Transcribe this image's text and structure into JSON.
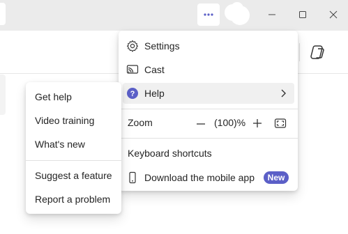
{
  "menu": {
    "settings_label": "Settings",
    "cast_label": "Cast",
    "help_label": "Help",
    "zoom_label": "Zoom",
    "zoom_value": "(100)%",
    "shortcuts_label": "Keyboard shortcuts",
    "mobile_label": "Download the mobile app",
    "new_badge": "New"
  },
  "help_submenu": {
    "items": [
      "Get help",
      "Video training",
      "What's new",
      "Suggest a feature",
      "Report a problem"
    ]
  },
  "colors": {
    "accent": "#5b5fc7",
    "titlebar": "#ebebeb"
  },
  "icons": {
    "more": "more-horizontal-icon",
    "settings": "gear-icon",
    "cast": "cast-icon",
    "help": "help-circle-icon",
    "zoom_out": "minus-icon",
    "zoom_in": "plus-icon",
    "fullscreen": "fullscreen-icon",
    "mobile": "phone-icon",
    "copilot": "copilot-icon"
  }
}
